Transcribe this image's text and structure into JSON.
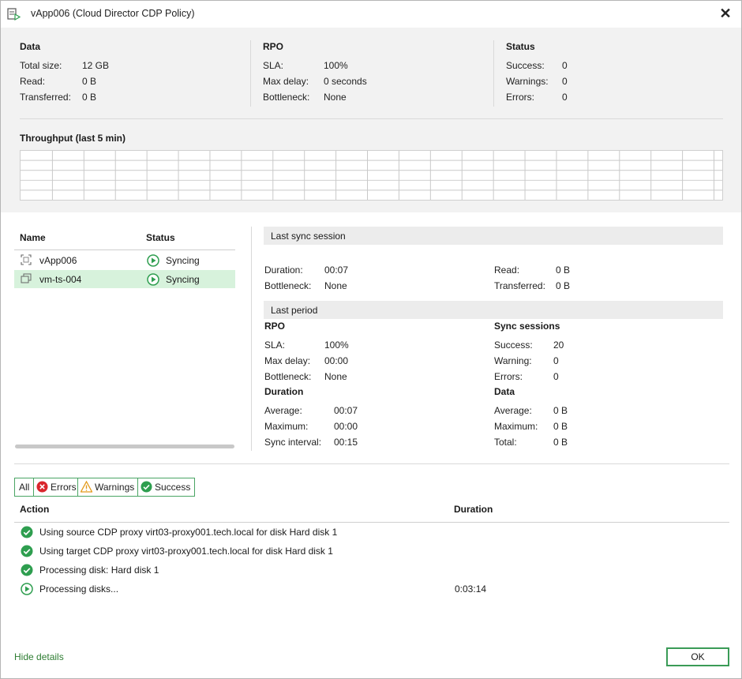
{
  "window": {
    "title": "vApp006 (Cloud Director CDP Policy)"
  },
  "summary": {
    "data": {
      "title": "Data",
      "rows": [
        {
          "label": "Total size:",
          "value": "12 GB"
        },
        {
          "label": "Read:",
          "value": "0 B"
        },
        {
          "label": "Transferred:",
          "value": "0 B"
        }
      ]
    },
    "rpo": {
      "title": "RPO",
      "rows": [
        {
          "label": "SLA:",
          "value": "100%"
        },
        {
          "label": "Max delay:",
          "value": "0 seconds"
        },
        {
          "label": "Bottleneck:",
          "value": "None"
        }
      ]
    },
    "status": {
      "title": "Status",
      "rows": [
        {
          "label": "Success:",
          "value": "0"
        },
        {
          "label": "Warnings:",
          "value": "0"
        },
        {
          "label": "Errors:",
          "value": "0"
        }
      ]
    },
    "throughput_title": "Throughput (last 5 min)"
  },
  "objects": {
    "headers": {
      "name": "Name",
      "status": "Status"
    },
    "items": [
      {
        "name": "vApp006",
        "status": "Syncing",
        "icon": "vapp-icon"
      },
      {
        "name": "vm-ts-004",
        "status": "Syncing",
        "icon": "vm-icon"
      }
    ]
  },
  "details": {
    "last_sync": {
      "title": "Last sync session",
      "left": [
        {
          "label": "Duration:",
          "value": "00:07"
        },
        {
          "label": "Bottleneck:",
          "value": "None"
        }
      ],
      "right": [
        {
          "label": "Read:",
          "value": "0 B"
        },
        {
          "label": "Transferred:",
          "value": "0 B"
        }
      ]
    },
    "last_period": {
      "title": "Last period",
      "rpo": {
        "title": "RPO",
        "rows": [
          {
            "label": "SLA:",
            "value": "100%"
          },
          {
            "label": "Max delay:",
            "value": "00:00"
          },
          {
            "label": "Bottleneck:",
            "value": "None"
          }
        ]
      },
      "sync_sessions": {
        "title": "Sync sessions",
        "rows": [
          {
            "label": "Success:",
            "value": "20"
          },
          {
            "label": "Warning:",
            "value": "0"
          },
          {
            "label": "Errors:",
            "value": "0"
          }
        ]
      },
      "duration": {
        "title": "Duration",
        "rows": [
          {
            "label": "Average:",
            "value": "00:07"
          },
          {
            "label": "Maximum:",
            "value": "00:00"
          },
          {
            "label": "Sync interval:",
            "value": "00:15"
          }
        ]
      },
      "data": {
        "title": "Data",
        "rows": [
          {
            "label": "Average:",
            "value": "0 B"
          },
          {
            "label": "Maximum:",
            "value": "0 B"
          },
          {
            "label": "Total:",
            "value": "0 B"
          }
        ]
      }
    }
  },
  "filters": {
    "all": "All",
    "errors": "Errors",
    "warnings": "Warnings",
    "success": "Success"
  },
  "actions": {
    "headers": {
      "action": "Action",
      "duration": "Duration"
    },
    "items": [
      {
        "text": "Using source CDP proxy virt03-proxy001.tech.local for disk Hard disk 1",
        "duration": "",
        "state": "success"
      },
      {
        "text": "Using target CDP proxy virt03-proxy001.tech.local for disk Hard disk 1",
        "duration": "",
        "state": "success"
      },
      {
        "text": "Processing disk: Hard disk 1",
        "duration": "",
        "state": "success"
      },
      {
        "text": "Processing disks...",
        "duration": "0:03:14",
        "state": "running"
      }
    ]
  },
  "footer": {
    "hide_details": "Hide details",
    "ok": "OK"
  },
  "colors": {
    "accent_green": "#2e9e4f",
    "error_red": "#d9262c",
    "warning_orange": "#e39a1b",
    "selection": "#d7f2dc"
  }
}
